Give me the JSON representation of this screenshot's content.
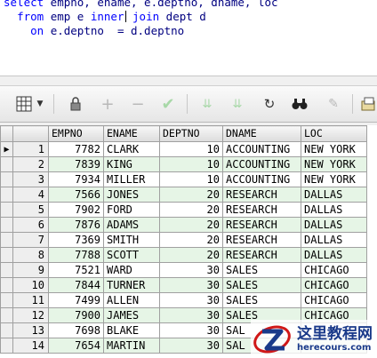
{
  "editor": {
    "lines": [
      "select empno, ename, e.deptno, dname, loc",
      "  from emp e inner join dept d",
      "    on e.deptno  = d.deptno"
    ]
  },
  "toolbar": {
    "icons": [
      "grid-icon",
      "dropdown-arrow-icon",
      "lock-icon",
      "plus-icon",
      "minus-icon",
      "check-icon",
      "down-double-arrow-icon",
      "down-double-arrow-alt-icon",
      "refresh-icon",
      "binoculars-icon",
      "eraser-icon",
      "export-icon"
    ]
  },
  "grid": {
    "columns": [
      "EMPNO",
      "ENAME",
      "DEPTNO",
      "DNAME",
      "LOC"
    ],
    "rows": [
      {
        "n": "1",
        "empno": "7782",
        "ename": "CLARK",
        "deptno": "10",
        "dname": "ACCOUNTING",
        "loc": "NEW YORK"
      },
      {
        "n": "2",
        "empno": "7839",
        "ename": "KING",
        "deptno": "10",
        "dname": "ACCOUNTING",
        "loc": "NEW YORK"
      },
      {
        "n": "3",
        "empno": "7934",
        "ename": "MILLER",
        "deptno": "10",
        "dname": "ACCOUNTING",
        "loc": "NEW YORK"
      },
      {
        "n": "4",
        "empno": "7566",
        "ename": "JONES",
        "deptno": "20",
        "dname": "RESEARCH",
        "loc": "DALLAS"
      },
      {
        "n": "5",
        "empno": "7902",
        "ename": "FORD",
        "deptno": "20",
        "dname": "RESEARCH",
        "loc": "DALLAS"
      },
      {
        "n": "6",
        "empno": "7876",
        "ename": "ADAMS",
        "deptno": "20",
        "dname": "RESEARCH",
        "loc": "DALLAS"
      },
      {
        "n": "7",
        "empno": "7369",
        "ename": "SMITH",
        "deptno": "20",
        "dname": "RESEARCH",
        "loc": "DALLAS"
      },
      {
        "n": "8",
        "empno": "7788",
        "ename": "SCOTT",
        "deptno": "20",
        "dname": "RESEARCH",
        "loc": "DALLAS"
      },
      {
        "n": "9",
        "empno": "7521",
        "ename": "WARD",
        "deptno": "30",
        "dname": "SALES",
        "loc": "CHICAGO"
      },
      {
        "n": "10",
        "empno": "7844",
        "ename": "TURNER",
        "deptno": "30",
        "dname": "SALES",
        "loc": "CHICAGO"
      },
      {
        "n": "11",
        "empno": "7499",
        "ename": "ALLEN",
        "deptno": "30",
        "dname": "SALES",
        "loc": "CHICAGO"
      },
      {
        "n": "12",
        "empno": "7900",
        "ename": "JAMES",
        "deptno": "30",
        "dname": "SALES",
        "loc": "CHICAGO"
      },
      {
        "n": "13",
        "empno": "7698",
        "ename": "BLAKE",
        "deptno": "30",
        "dname": "SAL",
        "loc": ""
      },
      {
        "n": "14",
        "empno": "7654",
        "ename": "MARTIN",
        "deptno": "30",
        "dname": "SAL",
        "loc": ""
      }
    ],
    "current_row_marker": "▶"
  },
  "watermark": {
    "title": "这里教程网",
    "url": "herecours.com"
  },
  "colors": {
    "keyword": "#0000ff",
    "identifier": "#000080",
    "alt_row": "#e6f5e6"
  }
}
